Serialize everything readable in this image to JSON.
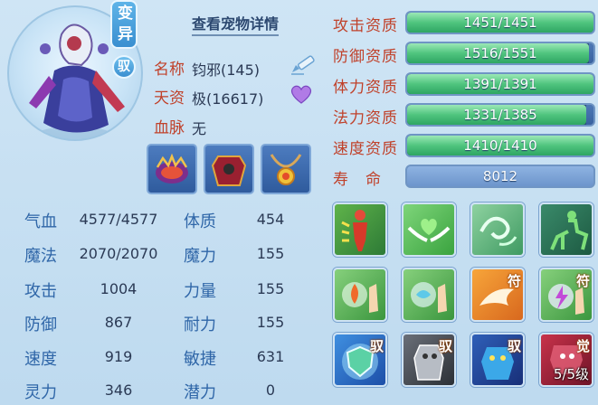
{
  "badges": {
    "mutant": "变异",
    "tame": "驭"
  },
  "detail_link": "查看宠物详情",
  "info": {
    "name_label": "名称",
    "name_value": "钧邪(145)",
    "talent_label": "天资",
    "talent_value": "极(16617)",
    "blood_label": "血脉",
    "blood_value": "无"
  },
  "icons": {
    "rename": "pencil-icon",
    "favorite": "heart-icon"
  },
  "equipment": [
    "crown-equip-icon",
    "armor-equip-icon",
    "necklace-equip-icon"
  ],
  "stats": [
    {
      "label": "气血",
      "value": "4577/4577"
    },
    {
      "label": "魔法",
      "value": "2070/2070"
    },
    {
      "label": "攻击",
      "value": "1004"
    },
    {
      "label": "防御",
      "value": "867"
    },
    {
      "label": "速度",
      "value": "919"
    },
    {
      "label": "灵力",
      "value": "346"
    }
  ],
  "attributes": [
    {
      "label": "体质",
      "value": "454"
    },
    {
      "label": "魔力",
      "value": "155"
    },
    {
      "label": "力量",
      "value": "155"
    },
    {
      "label": "耐力",
      "value": "155"
    },
    {
      "label": "敏捷",
      "value": "631"
    },
    {
      "label": "潜力",
      "value": "0"
    }
  ],
  "aptitudes": [
    {
      "label": "攻击资质",
      "text": "1451/1451",
      "fill": 1.0
    },
    {
      "label": "防御资质",
      "text": "1516/1551",
      "fill": 0.977
    },
    {
      "label": "体力资质",
      "text": "1391/1391",
      "fill": 1.0
    },
    {
      "label": "法力资质",
      "text": "1331/1385",
      "fill": 0.961
    },
    {
      "label": "速度资质",
      "text": "1410/1410",
      "fill": 1.0
    },
    {
      "label": "寿　命",
      "text": "8012",
      "fill": 0
    }
  ],
  "skills": [
    {
      "icon": "body-strength-skill-icon",
      "tag": "",
      "level": ""
    },
    {
      "icon": "heart-wings-skill-icon",
      "tag": "",
      "level": ""
    },
    {
      "icon": "wind-swirl-skill-icon",
      "tag": "",
      "level": ""
    },
    {
      "icon": "centaur-skill-icon",
      "tag": "",
      "level": ""
    },
    {
      "icon": "fire-palm-skill-icon",
      "tag": "",
      "level": ""
    },
    {
      "icon": "water-palm-skill-icon",
      "tag": "",
      "level": ""
    },
    {
      "icon": "wing-rune-skill-icon",
      "tag": "符",
      "level": ""
    },
    {
      "icon": "lightning-rune-skill-icon",
      "tag": "符",
      "level": ""
    },
    {
      "icon": "shield-tame-skill-icon",
      "tag": "驭",
      "level": ""
    },
    {
      "icon": "stone-golem-tame-skill-icon",
      "tag": "驭",
      "level": ""
    },
    {
      "icon": "blue-beast-tame-skill-icon",
      "tag": "驭",
      "level": ""
    },
    {
      "icon": "awaken-skill-icon",
      "tag": "觉",
      "level": "5/5级"
    }
  ]
}
